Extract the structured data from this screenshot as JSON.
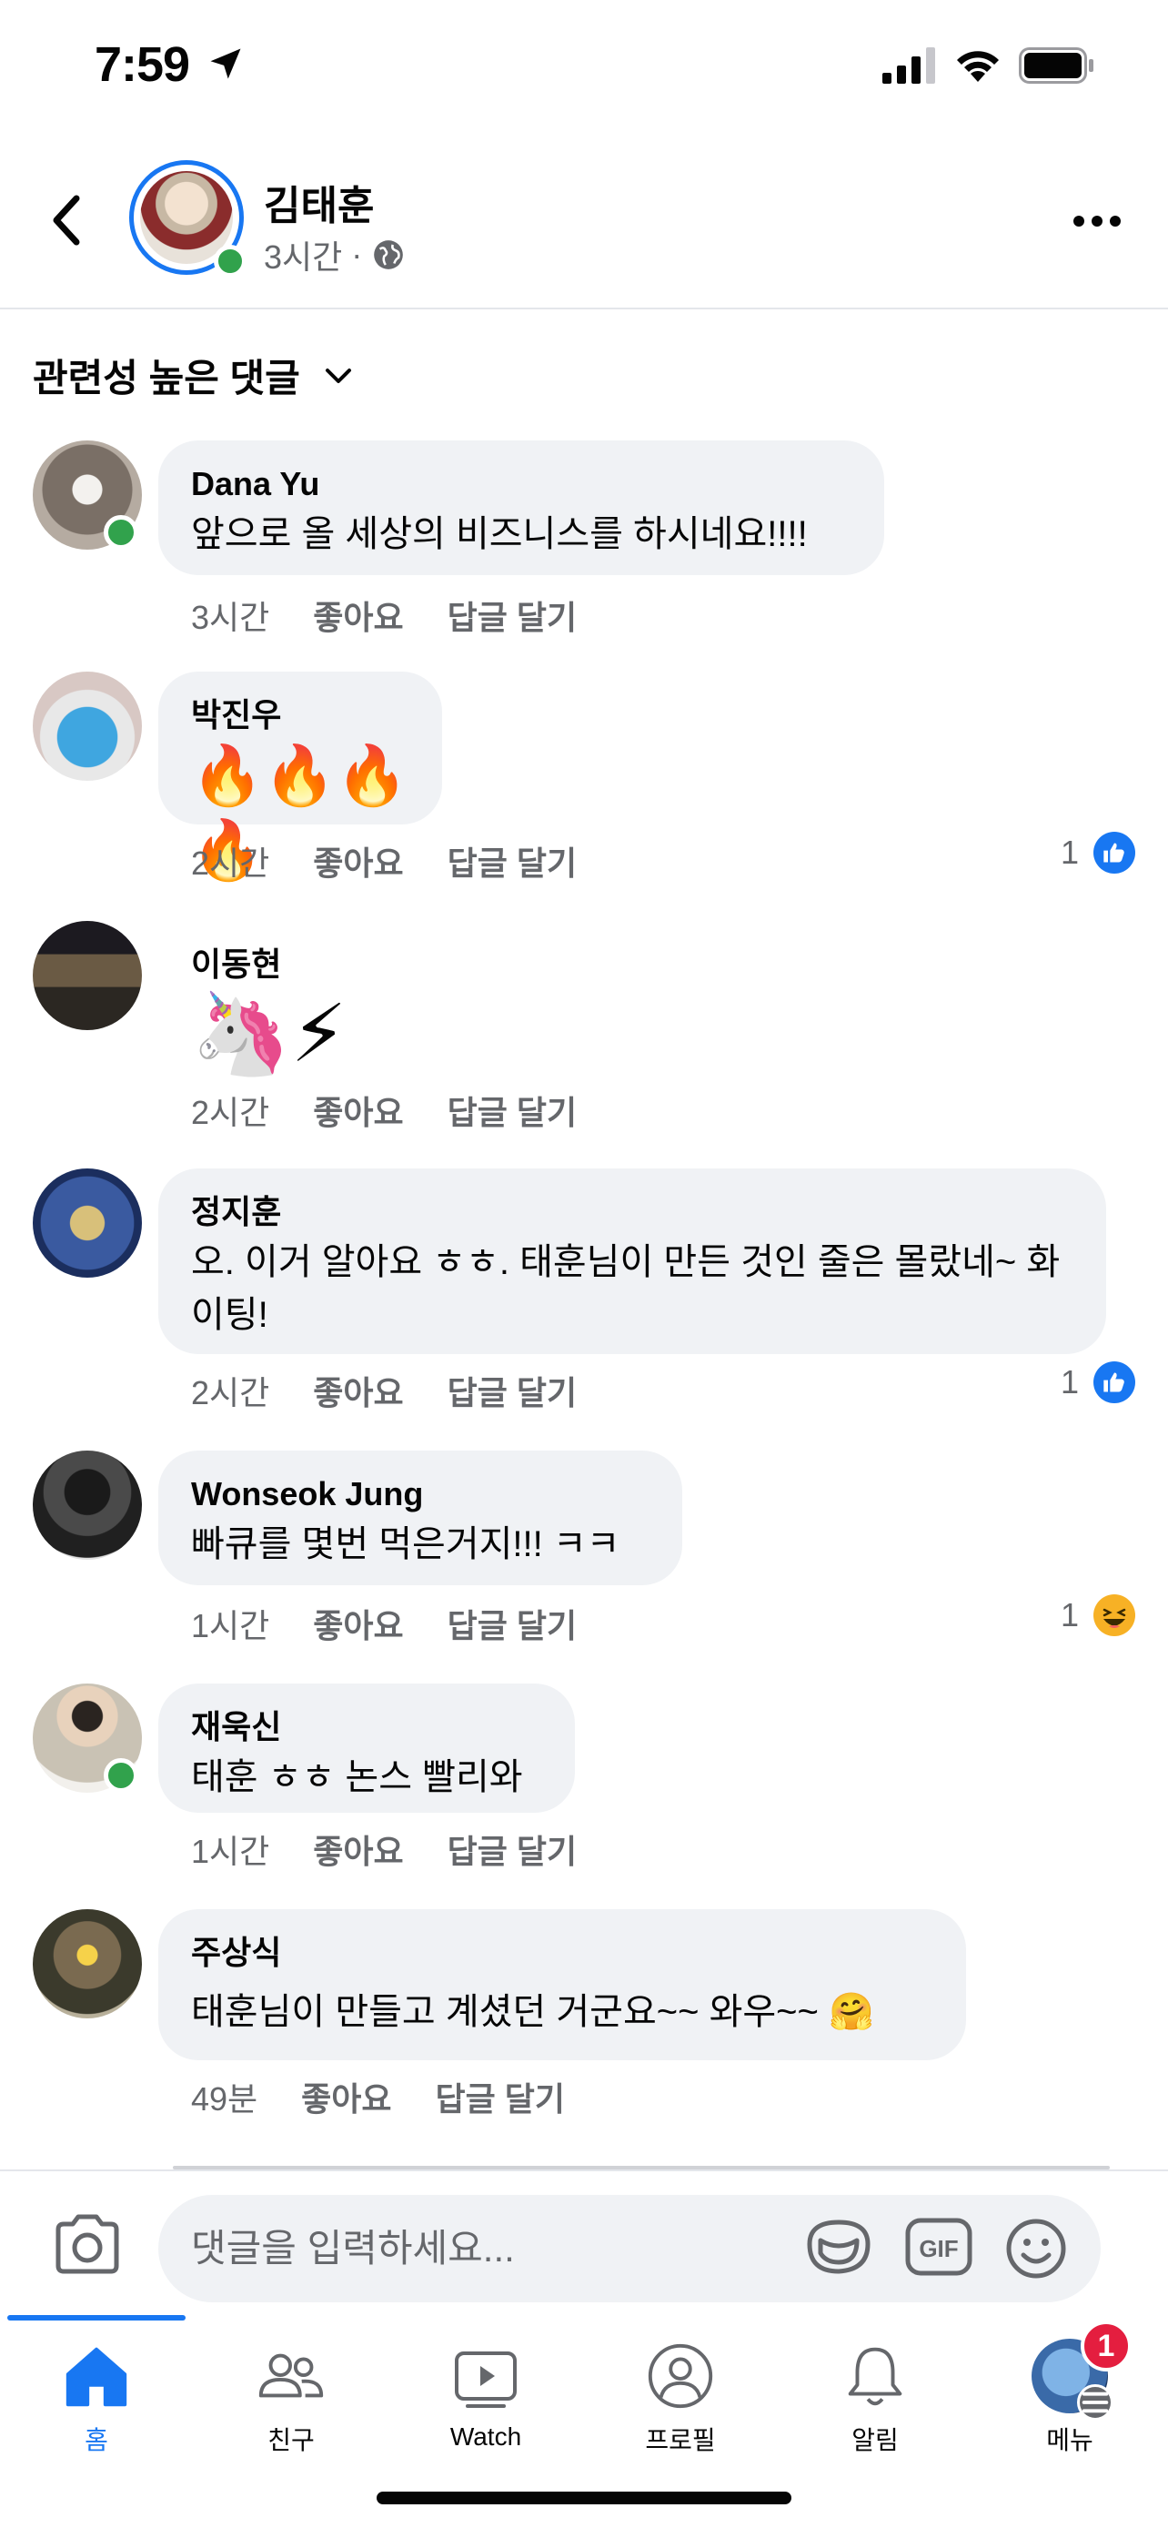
{
  "status_bar": {
    "time": "7:59"
  },
  "post": {
    "author": "김태훈",
    "time": "3시간",
    "separator": "·",
    "privacy_icon": "globe-icon",
    "online": true
  },
  "sort": {
    "label": "관련성 높은 댓글"
  },
  "actions": {
    "like": "좋아요",
    "reply": "답글 달기"
  },
  "comments": [
    {
      "name": "Dana Yu",
      "text": "앞으로 올 세상의 비즈니스를 하시네요!!!!",
      "time": "3시간",
      "online": true,
      "reaction": null,
      "avatar_color": "#9c8f86"
    },
    {
      "name": "박진우",
      "text": "🔥🔥🔥🔥",
      "time": "2시간",
      "online": false,
      "reaction": {
        "count": "1",
        "type": "like"
      },
      "avatar_color": "#4aa3d6"
    },
    {
      "name": "이동현",
      "text": "🦄⚡",
      "time": "2시간",
      "online": false,
      "reaction": null,
      "avatar_color": "#4a3b2c"
    },
    {
      "name": "정지훈",
      "text": "오. 이거 알아요 ㅎㅎ. 태훈님이 만든 것인 줄은 몰랐네~ 화이팅!",
      "time": "2시간",
      "online": false,
      "reaction": {
        "count": "1",
        "type": "like"
      },
      "avatar_color": "#2b4a8a"
    },
    {
      "name": "Wonseok Jung",
      "text": "빠큐를 몇번 먹은거지!!! ㅋㅋ",
      "time": "1시간",
      "online": false,
      "reaction": {
        "count": "1",
        "type": "haha"
      },
      "avatar_color": "#2a2a2a"
    },
    {
      "name": "재욱신",
      "text": "태훈 ㅎㅎ 논스 빨리와",
      "time": "1시간",
      "online": true,
      "reaction": null,
      "avatar_color": "#b9b2a6"
    },
    {
      "name": "주상식",
      "text": "태훈님이 만들고 계셨던 거군요~~ 와우~~ 🤗",
      "time": "49분",
      "online": false,
      "reaction": null,
      "avatar_color": "#3d3a2e"
    }
  ],
  "input": {
    "placeholder": "댓글을 입력하세요..."
  },
  "tabs": [
    {
      "label": "홈",
      "icon": "home-icon"
    },
    {
      "label": "친구",
      "icon": "friends-icon"
    },
    {
      "label": "Watch",
      "icon": "watch-icon"
    },
    {
      "label": "프로필",
      "icon": "profile-icon"
    },
    {
      "label": "알림",
      "icon": "bell-icon"
    },
    {
      "label": "메뉴",
      "icon": "menu-icon",
      "badge": "1"
    }
  ],
  "colors": {
    "accent": "#1877f2",
    "online": "#31a24c",
    "bubble": "#f0f2f5",
    "badge": "#e41e3f",
    "secondary_text": "#65676b"
  }
}
